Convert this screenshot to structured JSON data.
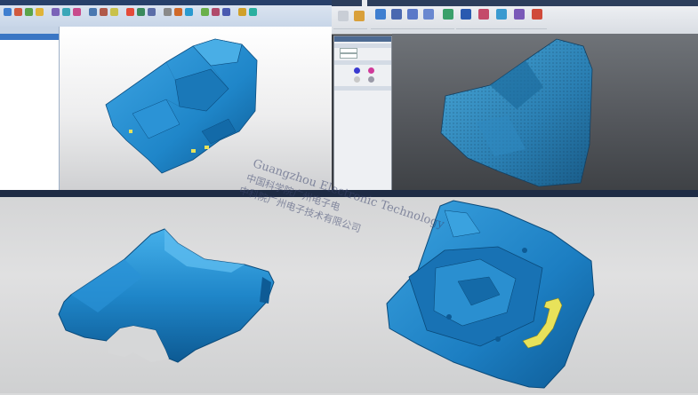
{
  "left_app": {
    "panel_title": "",
    "tree_items": [
      "",
      ""
    ],
    "view_info": [
      "",
      "",
      ""
    ],
    "status_text": ""
  },
  "right_app": {
    "tabs": [
      "",
      "",
      "",
      "",
      ""
    ],
    "dialog": {
      "title": "",
      "sections": [
        "",
        "",
        ""
      ],
      "rows": [
        "",
        "",
        "",
        ""
      ]
    },
    "status_text": ""
  },
  "watermark": {
    "line1": "Guangzhou Electronic Technology",
    "line2": "中国科学院广州电子电",
    "line3": "中科院广州电子技术有限公司"
  },
  "colors": {
    "scan_blue": "#1f86c9",
    "scan_dark": "#0d5a93",
    "accent_yellow": "#e8e25a"
  }
}
